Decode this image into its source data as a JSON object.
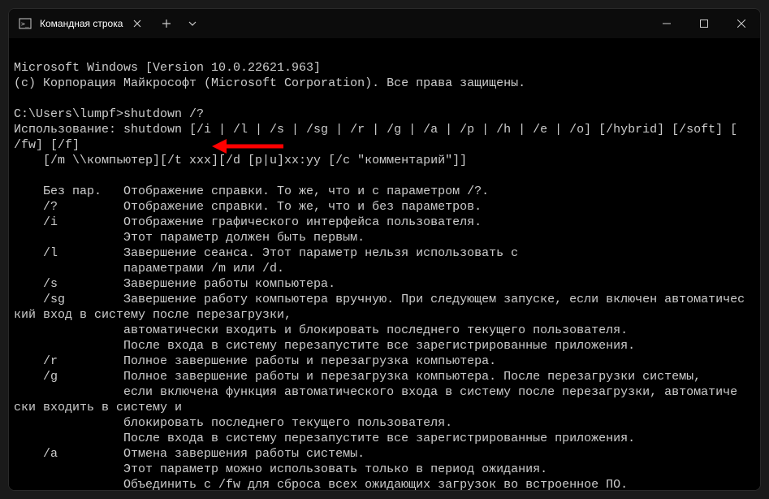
{
  "titlebar": {
    "tab_title": "Командная строка"
  },
  "terminal": {
    "line0": "Microsoft Windows [Version 10.0.22621.963]",
    "line1": "(c) Корпорация Майкрософт (Microsoft Corporation). Все права защищены.",
    "line2": "",
    "line3": "C:\\Users\\lumpf>shutdown /?",
    "line4": "Использование: shutdown [/i | /l | /s | /sg | /r | /g | /a | /p | /h | /e | /o] [/hybrid] [/soft] [",
    "line5": "/fw] [/f]",
    "line6": "    [/m \\\\компьютер][/t xxx][/d [p|u]xx:yy [/c \"комментарий\"]]",
    "line7": "",
    "line8": "    Без пар.   Отображение справки. То же, что и с параметром /?.",
    "line9": "    /?         Отображение справки. То же, что и без параметров.",
    "line10": "    /i         Отображение графического интерфейса пользователя.",
    "line11": "               Этот параметр должен быть первым.",
    "line12": "    /l         Завершение сеанса. Этот параметр нельзя использовать с",
    "line13": "               параметрами /m или /d.",
    "line14": "    /s         Завершение работы компьютера.",
    "line15": "    /sg        Завершение работу компьютера вручную. При следующем запуске, если включен автоматичес",
    "line16": "кий вход в систему после перезагрузки,",
    "line17": "               автоматически входить и блокировать последнего текущего пользователя.",
    "line18": "               После входа в систему перезапустите все зарегистрированные приложения.",
    "line19": "    /r         Полное завершение работы и перезагрузка компьютера.",
    "line20": "    /g         Полное завершение работы и перезагрузка компьютера. После перезагрузки системы,",
    "line21": "               если включена функция автоматического входа в систему после перезагрузки, автоматиче",
    "line22": "ски входить в систему и",
    "line23": "               блокировать последнего текущего пользователя.",
    "line24": "               После входа в систему перезапустите все зарегистрированные приложения.",
    "line25": "    /a         Отмена завершения работы системы.",
    "line26": "               Этот параметр можно использовать только в период ожидания.",
    "line27": "               Объединить с /fw для сброса всех ожидающих загрузок во встроенное ПО."
  }
}
